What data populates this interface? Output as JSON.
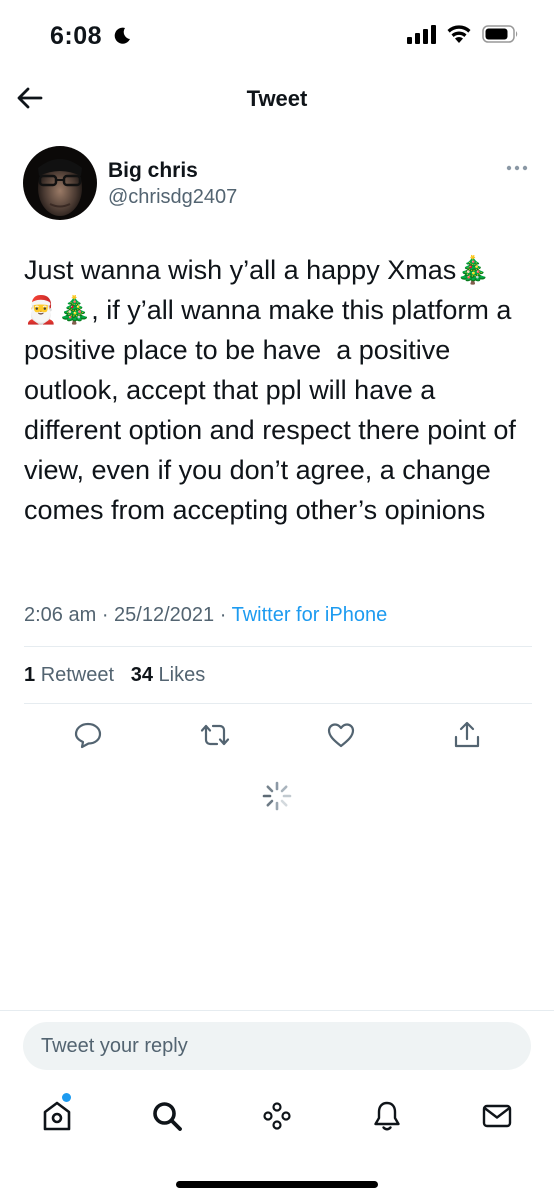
{
  "status_bar": {
    "time": "6:08"
  },
  "header": {
    "title": "Tweet"
  },
  "tweet": {
    "author_name": "Big chris",
    "author_handle": "@chrisdg2407",
    "text": "Just wanna wish y’all a happy Xmas🎄\n🎅🎄, if y’all wanna make this platform a positive place to be have  a positive outlook, accept that ppl will have a different option and respect there point of view, even if you don’t agree, a change comes from accepting other’s opinions",
    "time": "2:06 am",
    "separator": " · ",
    "date": "25/12/2021",
    "source": "Twitter for iPhone",
    "retweet_count": "1",
    "retweet_label": "Retweet",
    "like_count": "34",
    "like_label": "Likes"
  },
  "reply": {
    "placeholder": "Tweet your reply"
  },
  "colors": {
    "accent": "#1d9bf0",
    "muted": "#536471",
    "text": "#0f1419"
  },
  "icons": {
    "actions": [
      "reply-icon",
      "retweet-icon",
      "like-icon",
      "share-icon"
    ],
    "tabs": [
      "home-icon",
      "search-icon",
      "spaces-icon",
      "notifications-icon",
      "messages-icon"
    ]
  }
}
